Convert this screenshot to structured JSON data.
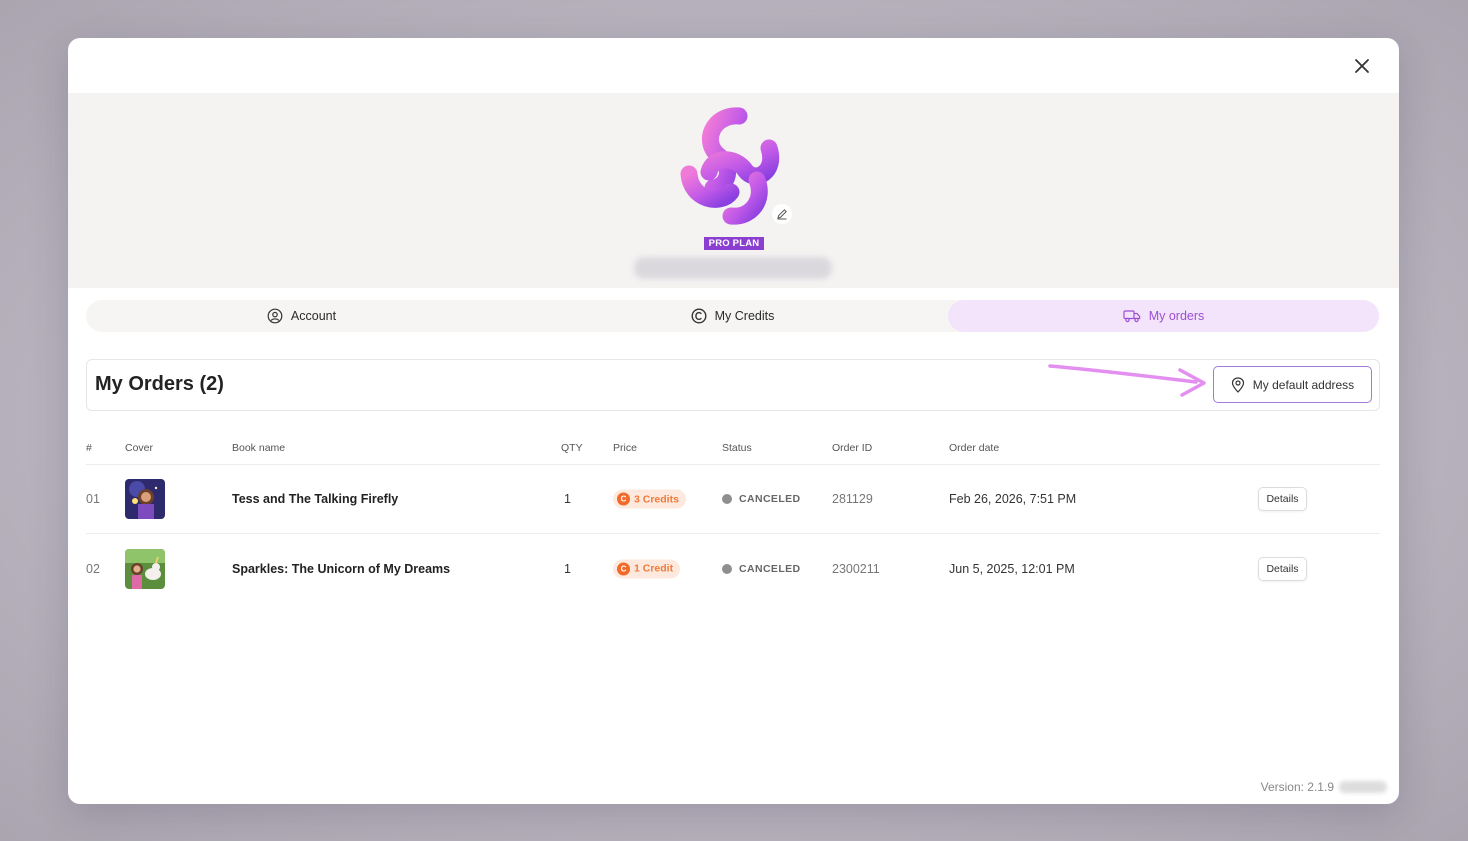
{
  "profile": {
    "plan_badge": "PRO PLAN"
  },
  "tabs": [
    {
      "label": "Account",
      "icon": "user-circle-icon"
    },
    {
      "label": "My Credits",
      "icon": "copyright-coin-icon"
    },
    {
      "label": "My orders",
      "icon": "truck-icon",
      "active": true
    }
  ],
  "orders": {
    "title": "My Orders (2)",
    "address_button": "My default address",
    "columns": [
      "#",
      "Cover",
      "Book name",
      "QTY",
      "Price",
      "Status",
      "Order ID",
      "Order date"
    ],
    "rows": [
      {
        "num": "01",
        "book": "Tess and The Talking Firefly",
        "qty": "1",
        "price": "3 Credits",
        "status": "CANCELED",
        "order_id": "281129",
        "date": "Feb 26, 2026, 7:51 PM",
        "action": "Details"
      },
      {
        "num": "02",
        "book": "Sparkles: The Unicorn of My Dreams",
        "qty": "1",
        "price": "1 Credit",
        "status": "CANCELED",
        "order_id": "2300211",
        "date": "Jun 5, 2025, 12:01 PM",
        "action": "Details"
      }
    ]
  },
  "footer": {
    "version": "Version: 2.1.9"
  },
  "colors": {
    "accent": "#9b4fd6",
    "active_tab_bg": "#f3e4fb",
    "credit_orange": "#f26a2a",
    "plan_badge": "#8a3fd1"
  }
}
